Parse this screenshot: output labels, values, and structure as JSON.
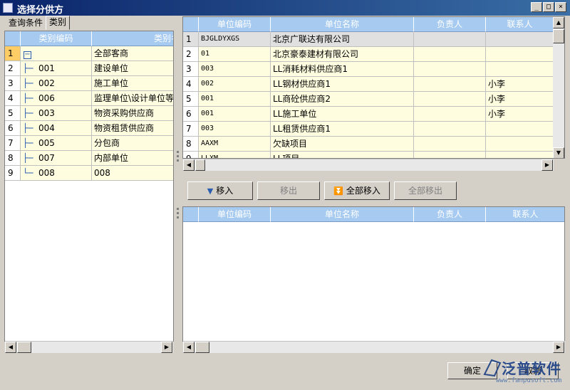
{
  "window": {
    "title": "选择分供方",
    "min": "_",
    "max": "□",
    "close": "×"
  },
  "tabs": [
    {
      "label": "查询条件"
    },
    {
      "label": "类别"
    }
  ],
  "category_grid": {
    "headers": [
      "",
      "类别编码",
      "类别名称"
    ],
    "rows": [
      {
        "num": "1",
        "code": "",
        "name": "全部客商",
        "expander": "−"
      },
      {
        "num": "2",
        "code": "001",
        "name": "建设单位"
      },
      {
        "num": "3",
        "code": "002",
        "name": "施工单位"
      },
      {
        "num": "4",
        "code": "006",
        "name": "监理单位\\设计单位等"
      },
      {
        "num": "5",
        "code": "003",
        "name": "物资采购供应商"
      },
      {
        "num": "6",
        "code": "004",
        "name": "物资租赁供应商"
      },
      {
        "num": "7",
        "code": "005",
        "name": "分包商"
      },
      {
        "num": "8",
        "code": "007",
        "name": "内部单位"
      },
      {
        "num": "9",
        "code": "008",
        "name": "008"
      }
    ]
  },
  "supplier_grid": {
    "headers": [
      "",
      "单位编码",
      "单位名称",
      "负责人",
      "联系人"
    ],
    "rows": [
      {
        "num": "1",
        "code": "BJGLDYXGS",
        "name": "北京广联达有限公司",
        "owner": "",
        "contact": ""
      },
      {
        "num": "2",
        "code": "01",
        "name": "北京豪泰建材有限公司",
        "owner": "",
        "contact": ""
      },
      {
        "num": "3",
        "code": "003",
        "name": "LL消耗材料供应商1",
        "owner": "",
        "contact": ""
      },
      {
        "num": "4",
        "code": "002",
        "name": "LL钢材供应商1",
        "owner": "",
        "contact": "小李"
      },
      {
        "num": "5",
        "code": "001",
        "name": "LL商砼供应商2",
        "owner": "",
        "contact": "小李"
      },
      {
        "num": "6",
        "code": "001",
        "name": "LL施工单位",
        "owner": "",
        "contact": "小李"
      },
      {
        "num": "7",
        "code": "003",
        "name": "LL租赁供应商1",
        "owner": "",
        "contact": ""
      },
      {
        "num": "8",
        "code": "AAXM",
        "name": "欠缺项目",
        "owner": "",
        "contact": ""
      },
      {
        "num": "9",
        "code": "LLXM",
        "name": "LL项目",
        "owner": "",
        "contact": ""
      }
    ]
  },
  "actions": {
    "move_in": "移入",
    "move_out": "移出",
    "move_all_in": "全部移入",
    "move_all_out": "全部移出"
  },
  "selected_grid": {
    "headers": [
      "",
      "单位编码",
      "单位名称",
      "负责人",
      "联系人"
    ]
  },
  "footer": {
    "ok": "确定",
    "cancel": "取消"
  },
  "watermark": {
    "brand": "泛普软件",
    "url": "www.fanpusoft.com"
  }
}
